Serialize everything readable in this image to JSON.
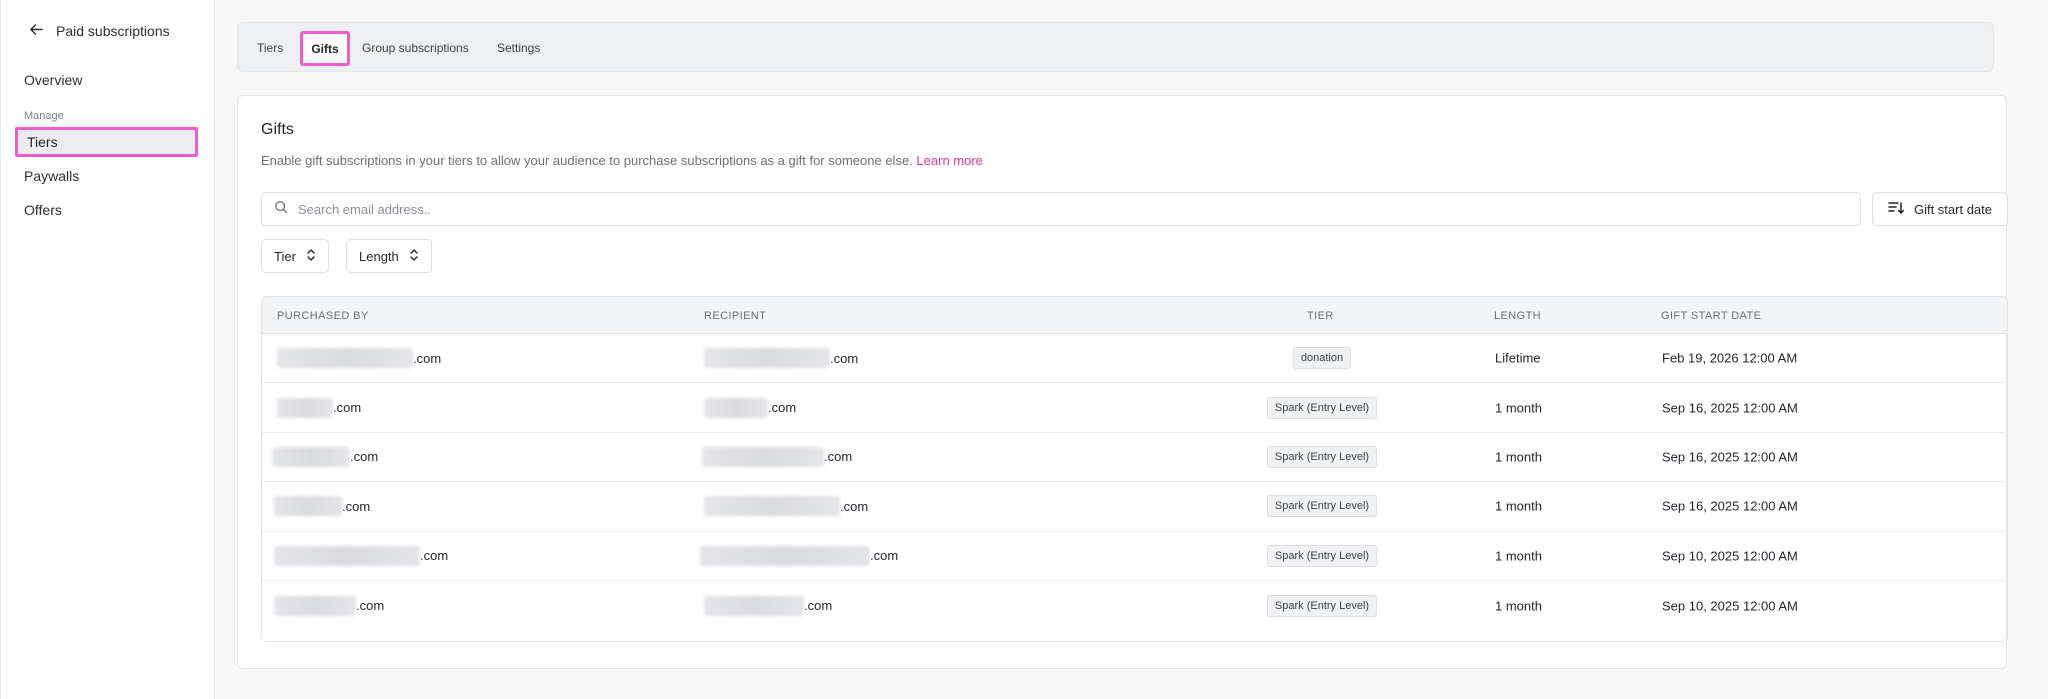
{
  "sidebar": {
    "back_label": "Paid subscriptions",
    "overview": "Overview",
    "section_label": "Manage",
    "items": [
      {
        "label": "Tiers"
      },
      {
        "label": "Paywalls"
      },
      {
        "label": "Offers"
      }
    ]
  },
  "tabs": [
    {
      "label": "Tiers"
    },
    {
      "label": "Gifts"
    },
    {
      "label": "Group subscriptions"
    },
    {
      "label": "Settings"
    }
  ],
  "gifts": {
    "title": "Gifts",
    "description": "Enable gift subscriptions in your tiers to allow your audience to purchase subscriptions as a gift for someone else.",
    "learn_more": "Learn more",
    "search_placeholder": "Search email address..",
    "sort_label": "Gift start date",
    "filters": {
      "tier": "Tier",
      "length": "Length"
    }
  },
  "table": {
    "headers": {
      "purchased_by": "PURCHASED BY",
      "recipient": "RECIPIENT",
      "tier": "TIER",
      "length": "LENGTH",
      "start_date": "GIFT START DATE"
    },
    "rows": [
      {
        "purchased_suffix": ".com",
        "recipient_suffix": ".com",
        "tier": "donation",
        "length": "Lifetime",
        "start_date": "Feb 19, 2026 12:00 AM"
      },
      {
        "purchased_suffix": ".com",
        "recipient_suffix": ".com",
        "tier": "Spark (Entry Level)",
        "length": "1 month",
        "start_date": "Sep 16, 2025 12:00 AM"
      },
      {
        "purchased_suffix": ".com",
        "recipient_suffix": ".com",
        "tier": "Spark (Entry Level)",
        "length": "1 month",
        "start_date": "Sep 16, 2025 12:00 AM"
      },
      {
        "purchased_suffix": ".com",
        "recipient_suffix": ".com",
        "tier": "Spark (Entry Level)",
        "length": "1 month",
        "start_date": "Sep 16, 2025 12:00 AM"
      },
      {
        "purchased_suffix": ".com",
        "recipient_suffix": ".com",
        "tier": "Spark (Entry Level)",
        "length": "1 month",
        "start_date": "Sep 10, 2025 12:00 AM"
      },
      {
        "purchased_suffix": ".com",
        "recipient_suffix": ".com",
        "tier": "Spark (Entry Level)",
        "length": "1 month",
        "start_date": "Sep 10, 2025 12:00 AM"
      }
    ]
  }
}
